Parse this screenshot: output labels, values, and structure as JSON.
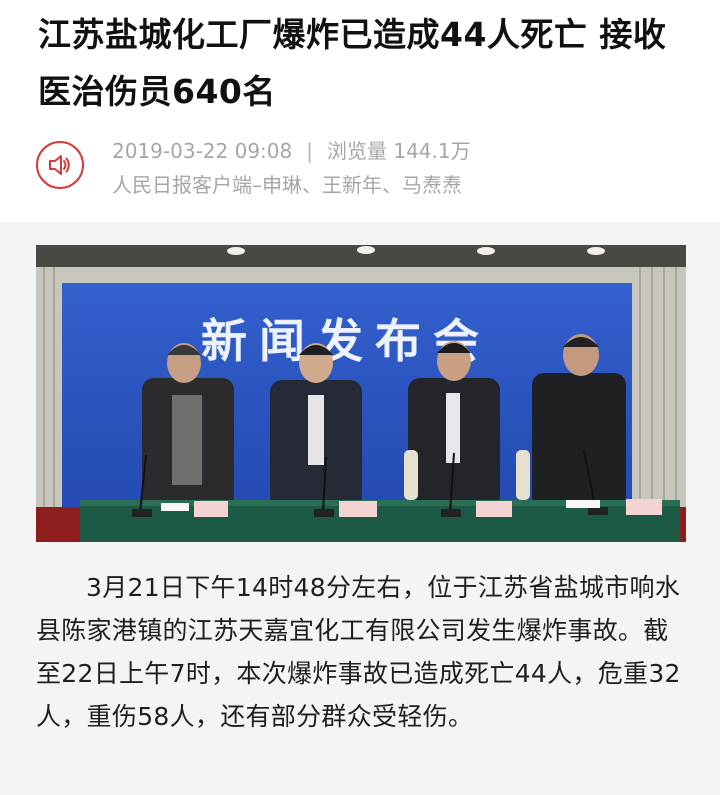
{
  "article": {
    "title": "江苏盐城化工厂爆炸已造成44人死亡 接收医治伤员640名",
    "date": "2019-03-22 09:08",
    "separator": "|",
    "views": "浏览量 144.1万",
    "source": "人民日报客户端–申琳、王新年、马焘焘",
    "audio_icon": "speaker-icon",
    "accent_color": "#d9393a",
    "body": "3月21日下午14时48分左右，位于江苏省盐城市响水县陈家港镇的江苏天嘉宜化工有限公司发生爆炸事故。截至22日上午7时，本次爆炸事故已造成死亡44人，危重32人，重伤58人，还有部分群众受轻伤。"
  },
  "photo": {
    "banner_text": "新闻发布会",
    "nameplates": [
      "",
      "",
      "",
      ""
    ]
  }
}
